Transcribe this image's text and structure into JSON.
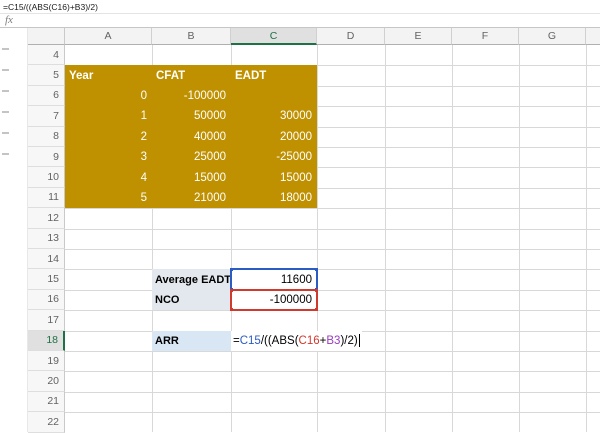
{
  "formula_bar": {
    "formula": "=C15/((ABS(C16)+B3)/2)",
    "fx_label": "fx"
  },
  "grid": {
    "column_letters": [
      "A",
      "B",
      "C",
      "D",
      "E",
      "F",
      "G"
    ],
    "row_numbers": [
      4,
      5,
      6,
      7,
      8,
      9,
      10,
      11,
      12,
      13,
      14,
      15,
      16,
      17,
      18,
      19,
      20,
      21,
      22
    ],
    "active_column": "C",
    "active_row": 18
  },
  "cfat_table": {
    "range": "A5:C11",
    "headers": {
      "year_label": "Year",
      "cfat_label": "CFAT",
      "eadt_label": "EADT"
    },
    "rows": [
      {
        "year": "0",
        "cfat": "-100000",
        "eadt": ""
      },
      {
        "year": "1",
        "cfat": "50000",
        "eadt": "30000"
      },
      {
        "year": "2",
        "cfat": "40000",
        "eadt": "20000"
      },
      {
        "year": "3",
        "cfat": "25000",
        "eadt": "-25000"
      },
      {
        "year": "4",
        "cfat": "15000",
        "eadt": "15000"
      },
      {
        "year": "5",
        "cfat": "21000",
        "eadt": "18000"
      }
    ]
  },
  "summary": {
    "average_eadt": {
      "label": "Average EADT",
      "cell": "C15",
      "value": "11600"
    },
    "nco": {
      "label": "NCO",
      "cell": "C16",
      "value": "-100000"
    },
    "arr": {
      "label": "ARR",
      "cell": "C18"
    }
  },
  "formula_edit": {
    "cell": "C18",
    "tokens": [
      {
        "text": "=",
        "color": "#000000"
      },
      {
        "text": "C15",
        "color": "#2A5CC4"
      },
      {
        "text": "/((ABS(",
        "color": "#000000"
      },
      {
        "text": "C16",
        "color": "#D0392B"
      },
      {
        "text": "+",
        "color": "#000000"
      },
      {
        "text": "B3",
        "color": "#9A3BBE"
      },
      {
        "text": ")/2)",
        "color": "#000000"
      }
    ]
  },
  "colors": {
    "gold_fill": "#BF9000",
    "gold_text": "#FFFFFF",
    "label_gray_fill": "#E3E8EE",
    "label_blue_fill": "#D9E7F5",
    "ref_blue": "#2A5CC4",
    "ref_red": "#D0392B",
    "ref_purple": "#9A3BBE",
    "active_green": "#1E7145",
    "gridline": "#D8D8D8"
  }
}
